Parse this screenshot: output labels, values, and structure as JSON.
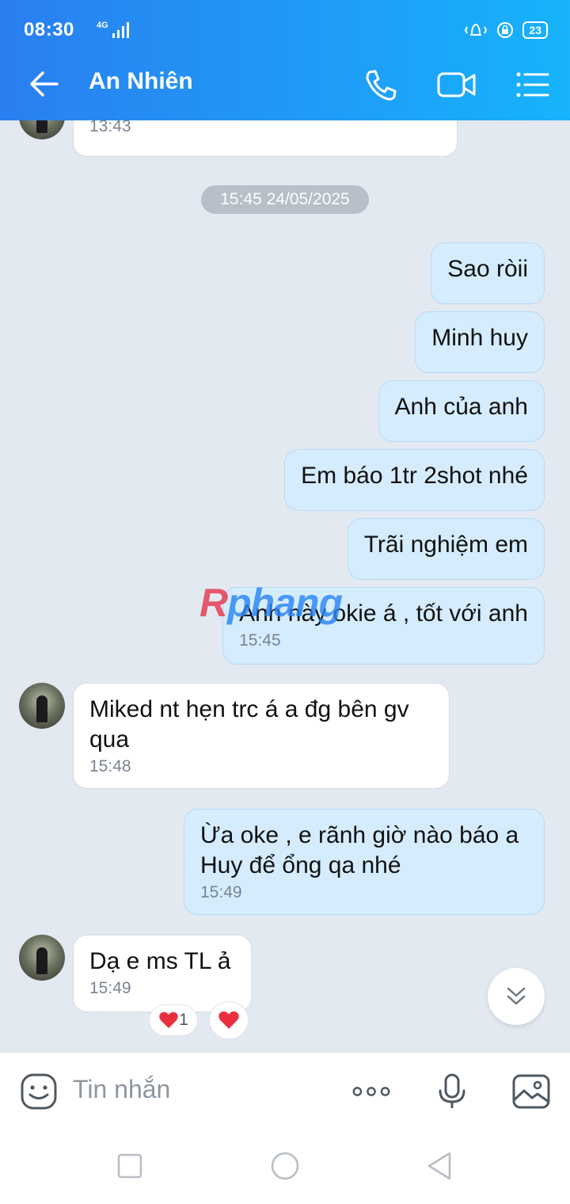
{
  "status": {
    "time": "08:30",
    "network": "4G",
    "battery": "23"
  },
  "header": {
    "title": "An Nhiên"
  },
  "messages": {
    "prev_time": "13:43",
    "date_separator": "15:45 24/05/2025",
    "out1": "Sao ròii",
    "out2": "Minh huy",
    "out3": "Anh của anh",
    "out4": "Em báo 1tr 2shot nhé",
    "out5": "Trãi nghiệm em",
    "out6": "Anh này okie á , tốt với anh",
    "out6_time": "15:45",
    "in1": "Miked nt hẹn trc á a đg bên gv qua",
    "in1_time": "15:48",
    "out7": "Ừa oke , e rãnh giờ nào báo a Huy để ổng qa nhé",
    "out7_time": "15:49",
    "in2": "Dạ e ms TL ả",
    "in2_time": "15:49",
    "reaction_count": "1"
  },
  "watermark": {
    "first": "R",
    "rest": "phang"
  },
  "input": {
    "placeholder": "Tin nhắn"
  },
  "colors": {
    "header_start": "#2a7ff0",
    "header_end": "#17b3fb",
    "bubble_out": "#d4ecfd",
    "bubble_in": "#ffffff",
    "heart": "#e8303f"
  },
  "icons": [
    "back-arrow-icon",
    "phone-icon",
    "video-camera-icon",
    "menu-list-icon",
    "emoji-icon",
    "more-dots-icon",
    "microphone-icon",
    "image-icon",
    "scroll-down-icon",
    "heart-icon"
  ]
}
